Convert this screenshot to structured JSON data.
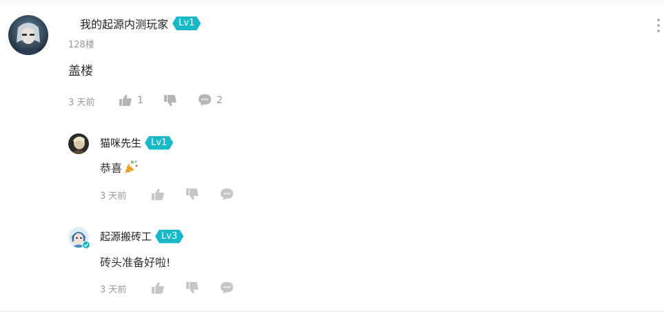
{
  "main_comment": {
    "username": "我的起源内测玩家",
    "level": "Lv1",
    "floor": "128楼",
    "content": "盖楼",
    "time": "3 天前",
    "like_count": "1",
    "reply_count": "2"
  },
  "replies": [
    {
      "username": "猫咪先生",
      "level": "Lv1",
      "content": "恭喜",
      "emoji": "party-popper",
      "time": "3 天前"
    },
    {
      "username": "起源搬砖工",
      "level": "Lv3",
      "content": "砖头准备好啦!",
      "time": "3 天前",
      "verified": true
    }
  ],
  "colors": {
    "level_badge": "#17b8c8",
    "meta_text": "#999999",
    "icon_gray": "#b5b5b5",
    "divider": "#eeeeee"
  }
}
